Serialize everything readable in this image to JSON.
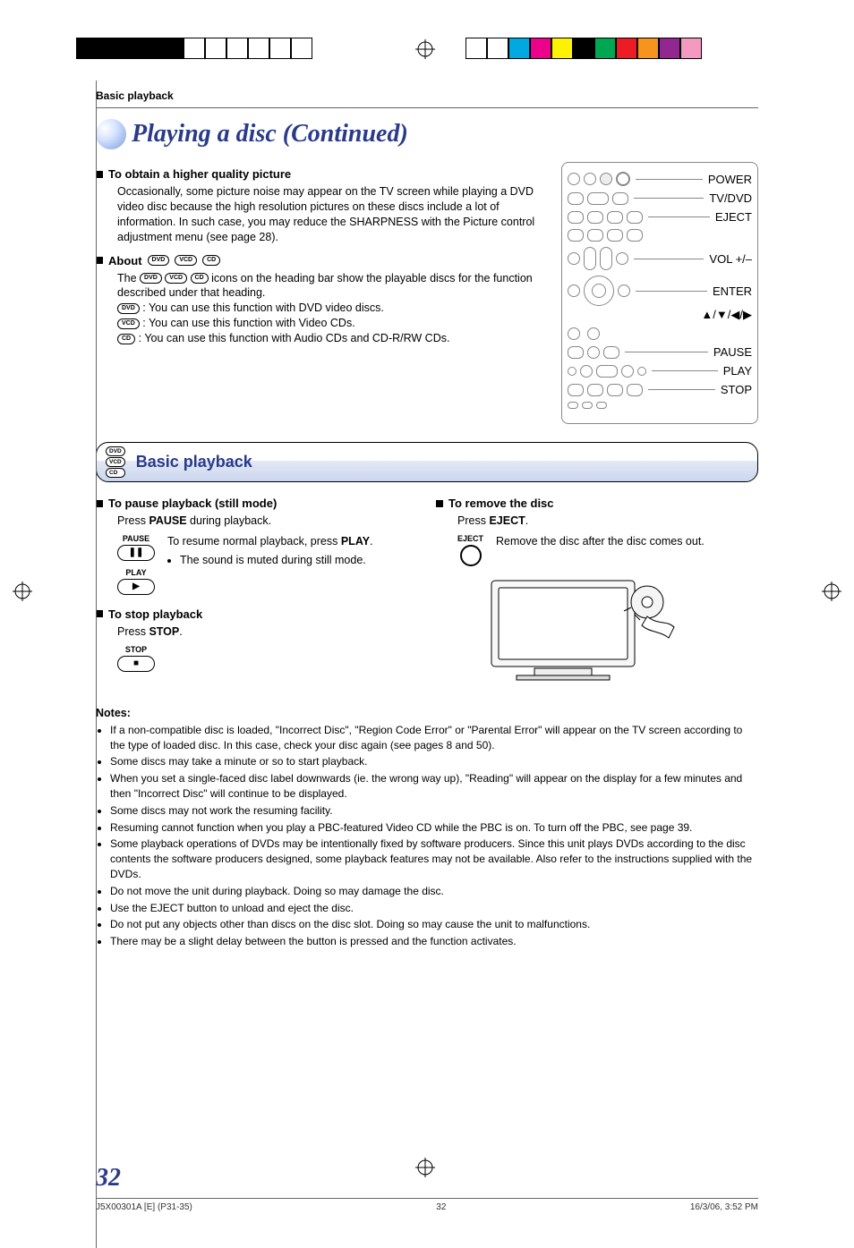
{
  "colorbar": [
    "#ffffff",
    "#ffffff",
    "#00a9e0",
    "#ec008c",
    "#fff200",
    "#000000",
    "#00a651",
    "#ed1c24",
    "#f7941d",
    "#92278f",
    "#f49ac1"
  ],
  "breadcrumb": "Basic playback",
  "title": "Playing a disc (Continued)",
  "sec1": {
    "heading": "To obtain a higher quality picture",
    "body": "Occasionally, some picture noise may appear on the TV screen while playing a DVD video disc because the high resolution pictures on these discs include a lot of information. In such case, you may reduce the SHARPNESS with the Picture control adjustment menu (see page 28)."
  },
  "sec2": {
    "heading_prefix": "About ",
    "ovals": [
      "DVD",
      "VCD",
      "CD"
    ],
    "line1_a": "The ",
    "line1_b": " icons on the heading bar show the playable discs for the function described under that heading.",
    "dvd": " : You can use this function with DVD video discs.",
    "vcd": " : You can use this function with Video CDs.",
    "cd": " : You can use this function with Audio CDs and CD-R/RW CDs."
  },
  "remote": {
    "labels": [
      "POWER",
      "TV/DVD",
      "EJECT",
      "VOL +/–",
      "ENTER",
      "▲/▼/◀/▶",
      "PAUSE",
      "PLAY",
      "STOP"
    ]
  },
  "section_bar": "Basic playback",
  "pause": {
    "heading": "To pause playback (still mode)",
    "press_a": "Press ",
    "press_bold": "PAUSE",
    "press_b": " during playback.",
    "resume_a": "To resume normal playback, press ",
    "resume_bold": "PLAY",
    "resume_b": ".",
    "note": "The sound is muted during still mode.",
    "btn_pause": "PAUSE",
    "btn_play": "PLAY"
  },
  "stop": {
    "heading": "To stop playback",
    "press_a": "Press ",
    "press_bold": "STOP",
    "press_b": ".",
    "btn": "STOP"
  },
  "remove": {
    "heading": "To remove the disc",
    "press_a": "Press ",
    "press_bold": "EJECT",
    "press_b": ".",
    "text": "Remove the disc after the disc comes out.",
    "btn": "EJECT"
  },
  "notes_heading": "Notes:",
  "notes": [
    "If a non-compatible disc is loaded, \"Incorrect Disc\", \"Region Code Error\" or \"Parental Error\" will appear on the TV screen according to the type of loaded disc. In this case, check your disc again (see pages 8 and 50).",
    "Some discs may take a minute or so to start playback.",
    "When you set a single-faced disc label downwards (ie. the wrong way up), \"Reading\" will appear on the display for a few minutes and then \"Incorrect Disc\" will continue to be displayed.",
    "Some discs may not work the resuming facility.",
    "Resuming cannot function when you play a PBC-featured Video CD while the PBC is on. To turn off the PBC, see page 39.",
    "Some playback operations of DVDs may be intentionally fixed by software producers. Since this unit plays DVDs according to the disc contents the software producers designed, some playback features may not be available. Also refer to the instructions supplied with the DVDs.",
    "Do not move the unit during playback. Doing so may damage the disc.",
    "Use the EJECT button to unload and eject the disc.",
    "Do not put any objects other than discs on the disc slot. Doing so may cause the unit to malfunctions.",
    "There may be a slight delay between the button is pressed and the function activates."
  ],
  "page_number": "32",
  "footer": {
    "left": "J5X00301A [E] (P31-35)",
    "mid": "32",
    "right": "16/3/06, 3:52 PM"
  }
}
